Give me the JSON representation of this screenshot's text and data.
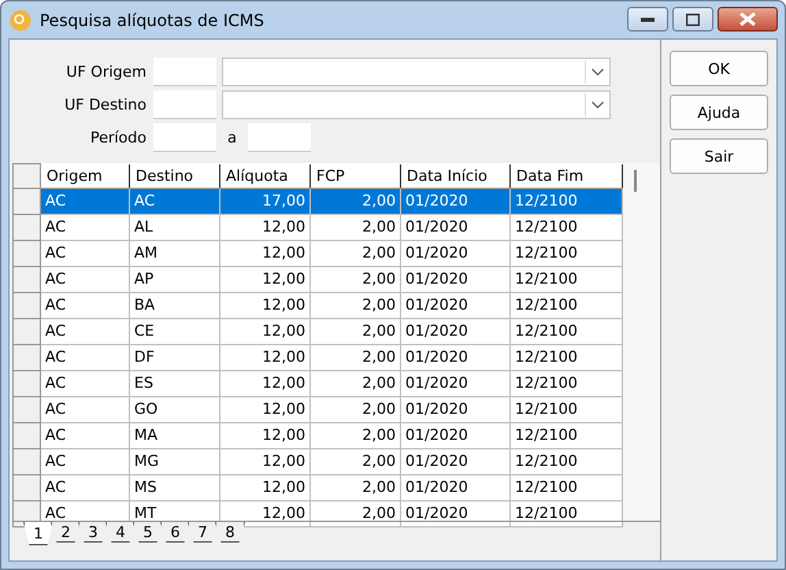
{
  "window": {
    "title": "Pesquisa alíquotas de ICMS"
  },
  "filters": [
    {
      "label": "UF Origem",
      "kind": "combo"
    },
    {
      "label": "UF Destino",
      "kind": "combo"
    },
    {
      "label": "Período",
      "kind": "range",
      "separator": "a"
    }
  ],
  "buttons": [
    "OK",
    "Ajuda",
    "Sair"
  ],
  "table": {
    "columns": [
      "Origem",
      "Destino",
      "Alíquota",
      "FCP",
      "Data Início",
      "Data Fim"
    ],
    "rows": [
      {
        "cells": [
          "AC",
          "AC",
          "17,00",
          "2,00",
          "01/2020",
          "12/2100"
        ],
        "selected": true
      },
      {
        "cells": [
          "AC",
          "AL",
          "12,00",
          "2,00",
          "01/2020",
          "12/2100"
        ],
        "selected": false
      },
      {
        "cells": [
          "AC",
          "AM",
          "12,00",
          "2,00",
          "01/2020",
          "12/2100"
        ],
        "selected": false
      },
      {
        "cells": [
          "AC",
          "AP",
          "12,00",
          "2,00",
          "01/2020",
          "12/2100"
        ],
        "selected": false
      },
      {
        "cells": [
          "AC",
          "BA",
          "12,00",
          "2,00",
          "01/2020",
          "12/2100"
        ],
        "selected": false
      },
      {
        "cells": [
          "AC",
          "CE",
          "12,00",
          "2,00",
          "01/2020",
          "12/2100"
        ],
        "selected": false
      },
      {
        "cells": [
          "AC",
          "DF",
          "12,00",
          "2,00",
          "01/2020",
          "12/2100"
        ],
        "selected": false
      },
      {
        "cells": [
          "AC",
          "ES",
          "12,00",
          "2,00",
          "01/2020",
          "12/2100"
        ],
        "selected": false
      },
      {
        "cells": [
          "AC",
          "GO",
          "12,00",
          "2,00",
          "01/2020",
          "12/2100"
        ],
        "selected": false
      },
      {
        "cells": [
          "AC",
          "MA",
          "12,00",
          "2,00",
          "01/2020",
          "12/2100"
        ],
        "selected": false
      },
      {
        "cells": [
          "AC",
          "MG",
          "12,00",
          "2,00",
          "01/2020",
          "12/2100"
        ],
        "selected": false
      },
      {
        "cells": [
          "AC",
          "MS",
          "12,00",
          "2,00",
          "01/2020",
          "12/2100"
        ],
        "selected": false
      },
      {
        "cells": [
          "AC",
          "MT",
          "12,00",
          "2,00",
          "01/2020",
          "12/2100"
        ],
        "selected": false
      }
    ]
  },
  "pages": [
    {
      "label": "1",
      "selected": true
    },
    {
      "label": "2",
      "selected": false
    },
    {
      "label": "3",
      "selected": false
    },
    {
      "label": "4",
      "selected": false
    },
    {
      "label": "5",
      "selected": false
    },
    {
      "label": "6",
      "selected": false
    },
    {
      "label": "7",
      "selected": false
    },
    {
      "label": "8",
      "selected": false
    }
  ]
}
